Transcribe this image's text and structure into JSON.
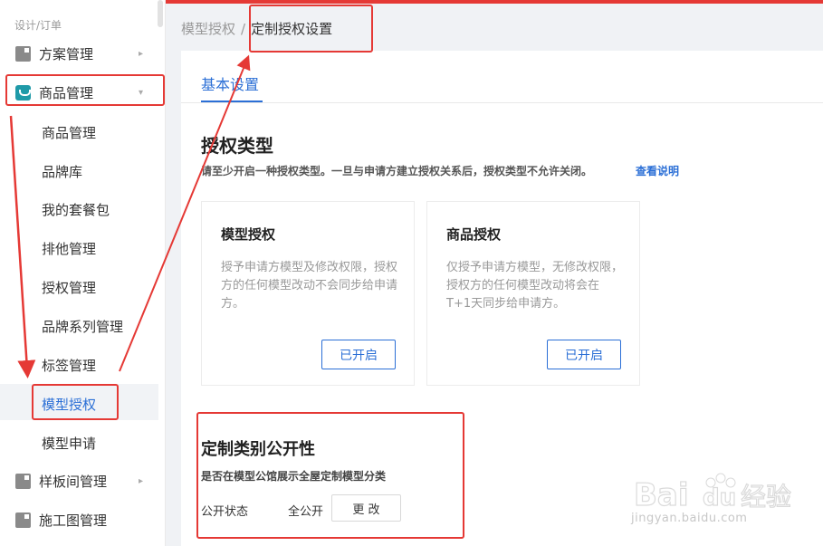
{
  "sidebar": {
    "section_title": "设计/订单",
    "groups": {
      "plan": {
        "label": "方案管理",
        "icon": "folder-icon"
      },
      "goods": {
        "label": "商品管理",
        "icon": "shop-bag-icon"
      },
      "sample": {
        "label": "样板间管理",
        "icon": "folder-icon"
      },
      "construction": {
        "label": "施工图管理",
        "icon": "folder-icon"
      }
    },
    "items": [
      "商品管理",
      "品牌库",
      "我的套餐包",
      "排他管理",
      "授权管理",
      "品牌系列管理",
      "标签管理",
      "模型授权",
      "模型申请"
    ],
    "active_item": "模型授权"
  },
  "breadcrumb": {
    "parent": "模型授权",
    "separator": "/",
    "current": "定制授权设置"
  },
  "tabs": {
    "basic": "基本设置"
  },
  "auth_type": {
    "heading": "授权类型",
    "description": "请至少开启一种授权类型。一旦与申请方建立授权关系后，授权类型不允许关闭。",
    "help_link": "查看说明",
    "cards": {
      "model": {
        "title": "模型授权",
        "text": "授予申请方模型及修改权限，授权方的任何模型改动不会同步给申请方。",
        "button": "已开启"
      },
      "goods": {
        "title": "商品授权",
        "text": "仅授予申请方模型，无修改权限，授权方的任何模型改动将会在T+1天同步给申请方。",
        "button": "已开启"
      }
    }
  },
  "category": {
    "heading": "定制类别公开性",
    "subtitle": "是否在模型公馆展示全屋定制模型分类",
    "status_label": "公开状态",
    "status_value": "全公开",
    "change_button": "更 改"
  },
  "watermark": {
    "logo": "Bai du 经验",
    "url": "jingyan.baidu.com"
  },
  "colors": {
    "accent": "#2b6fd6",
    "annotation": "#e53935"
  }
}
